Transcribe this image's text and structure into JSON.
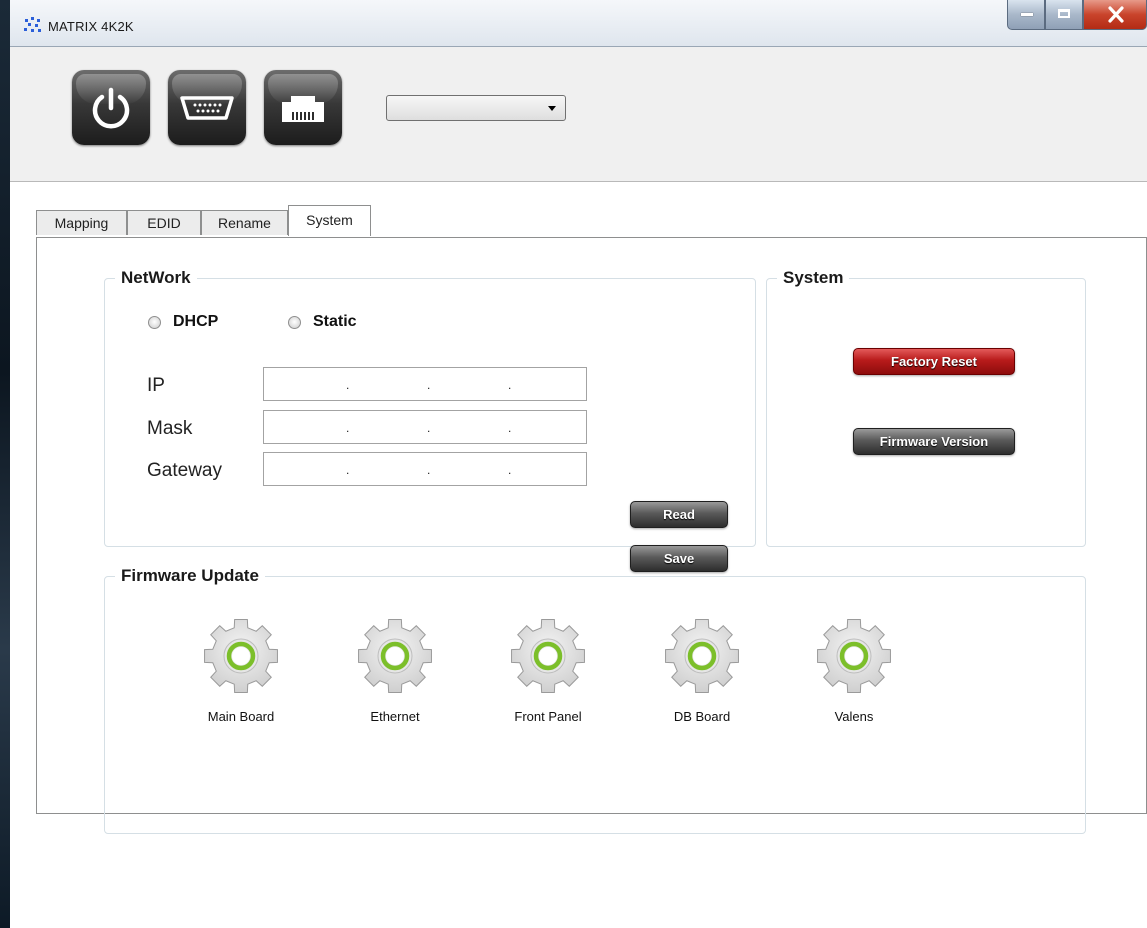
{
  "window": {
    "title": "MATRIX 4K2K"
  },
  "toolbar": {
    "power_icon": "power-icon",
    "serial_icon": "serial-port-icon",
    "ethernet_icon": "ethernet-port-icon",
    "port_select_value": ""
  },
  "tabs": [
    {
      "label": "Mapping",
      "active": false
    },
    {
      "label": "EDID",
      "active": false
    },
    {
      "label": "Rename",
      "active": false
    },
    {
      "label": "System",
      "active": true
    }
  ],
  "network": {
    "title": "NetWork",
    "dhcp_label": "DHCP",
    "static_label": "Static",
    "fields": [
      {
        "label": "IP",
        "value": ""
      },
      {
        "label": "Mask",
        "value": ""
      },
      {
        "label": "Gateway",
        "value": ""
      }
    ],
    "dot": ".",
    "read_label": "Read",
    "save_label": "Save"
  },
  "system": {
    "title": "System",
    "factory_reset_label": "Factory Reset",
    "firmware_version_label": "Firmware Version"
  },
  "firmware": {
    "title": "Firmware Update",
    "items": [
      {
        "label": "Main Board",
        "icon": "gear-icon"
      },
      {
        "label": "Ethernet",
        "icon": "gear-icon"
      },
      {
        "label": "Front Panel",
        "icon": "gear-icon"
      },
      {
        "label": "DB Board",
        "icon": "gear-icon"
      },
      {
        "label": "Valens",
        "icon": "gear-icon"
      }
    ]
  },
  "colors": {
    "accent_red": "#b81b1b",
    "gear_ring": "#7cbf2a",
    "panel_border": "#d5dfe5"
  }
}
